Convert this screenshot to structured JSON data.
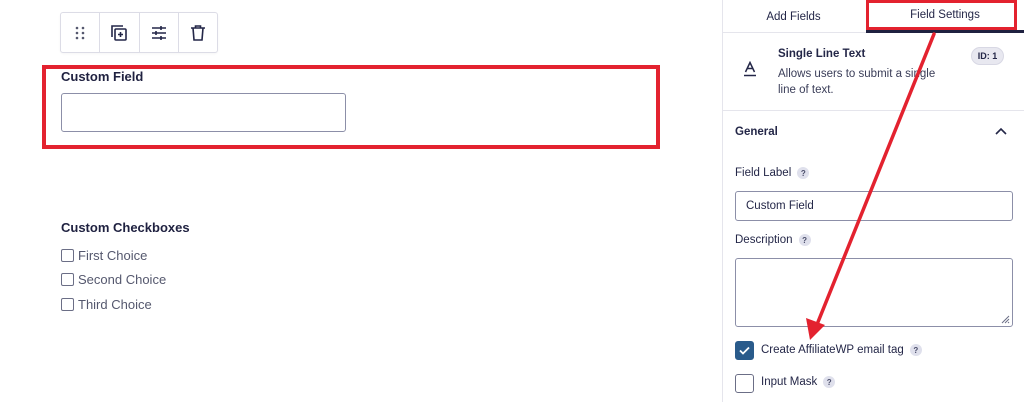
{
  "toolbar": {
    "items": [
      {
        "icon": "drag-handle-icon"
      },
      {
        "icon": "duplicate-icon"
      },
      {
        "icon": "sliders-icon"
      },
      {
        "icon": "trash-icon"
      }
    ]
  },
  "canvas": {
    "text_field": {
      "label": "Custom Field",
      "value": "",
      "placeholder": ""
    },
    "checkboxes": {
      "label": "Custom Checkboxes",
      "choices": [
        "First Choice",
        "Second Choice",
        "Third Choice"
      ]
    }
  },
  "panel": {
    "tabs": [
      {
        "label": "Add Fields",
        "active": false
      },
      {
        "label": "Field Settings",
        "active": true
      }
    ],
    "field_info": {
      "icon": "text-field-icon",
      "type": "Single Line Text",
      "description": "Allows users to submit a single line of text.",
      "id_badge": "ID: 1"
    },
    "general": {
      "title": "General",
      "field_label": {
        "label": "Field Label",
        "help": "?",
        "value": "Custom Field"
      },
      "description": {
        "label": "Description",
        "help": "?",
        "value": ""
      },
      "affiliate_tag": {
        "label": "Create AffiliateWP email tag",
        "help": "?",
        "checked": true
      },
      "input_mask": {
        "label": "Input Mask",
        "help": "?",
        "checked": false
      }
    }
  },
  "annotation": {
    "color": "#e3222f"
  }
}
